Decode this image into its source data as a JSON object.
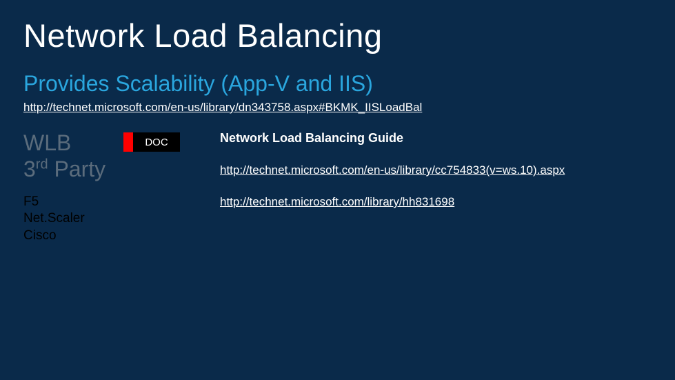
{
  "title": "Network Load Balancing",
  "subtitle": "Provides Scalability (App-V and IIS)",
  "top_link": "http://technet.microsoft.com/en-us/library/dn343758.aspx#BKMK_IISLoadBal",
  "left": {
    "wlb": "WLB",
    "third_party_prefix": "3",
    "third_party_suffix": "rd",
    "third_party_word": " Party",
    "vendors": [
      "F5",
      "Net.Scaler",
      "Cisco"
    ]
  },
  "badge": {
    "label": "DOC"
  },
  "right": {
    "guide_title": "Network Load Balancing Guide",
    "link_a": "http://technet.microsoft.com/en-us/library/cc754833(v=ws.10).aspx",
    "link_b": "http://technet.microsoft.com/library/hh831698"
  }
}
